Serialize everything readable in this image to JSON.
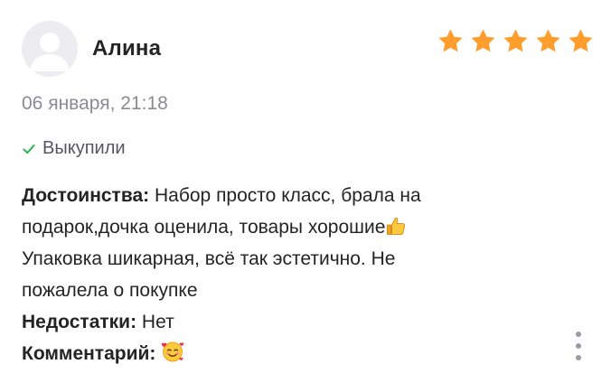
{
  "review": {
    "author": "Алина",
    "rating": 5,
    "rating_max": 5,
    "star_color": "#ff9e2c",
    "date": "06 января, 21:18",
    "status": "Выкупили",
    "status_icon": "check-icon",
    "status_color": "#2fb14a",
    "pros_label": "Достоинства:",
    "pros_line1": "Набор просто класс, брала на",
    "pros_line2": "подарок,дочка оценила, товары хорошие",
    "pros_line3": "Упаковка шикарная, всё так эстетично. Не",
    "pros_line4": "пожалела о покупке",
    "pros_emoji": "thumbs-up-icon",
    "cons_label": "Недостатки:",
    "cons_text": "Нет",
    "comment_label": "Комментарий:",
    "comment_emoji": "smiling-face-with-hearts-icon",
    "menu_icon": "more-vertical-icon"
  }
}
